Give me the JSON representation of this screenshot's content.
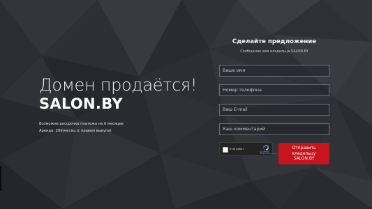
{
  "colors": {
    "background": "#2b2c31",
    "accent_button": "#c8141d",
    "field_border": "#6e6f77",
    "text": "#ffffff"
  },
  "sale": {
    "heading": "Домен продаётся!",
    "domain": "SALON.BY",
    "installments_note": "Возможна рассрочка платежа на 6 месяцев",
    "rent_note": "Аренда: 20$\\месяц (с правом выкупа)"
  },
  "offer_form": {
    "title": "Сделайте предложение",
    "subtitle": "Сообщение для владельца SALON.BY",
    "name_placeholder": "Ваше имя",
    "phone_placeholder": "Номер телефона",
    "email_placeholder": "Ваш E-mail",
    "comment_placeholder": "Ваш комментарий",
    "submit_label": "Отправить владельцу SALON.BY"
  },
  "captcha": {
    "checkbox_label": "Я не робот",
    "brand": "reCAPTCHA",
    "links": "Конфиденциальность - Условия",
    "icon": "recaptcha-icon"
  }
}
